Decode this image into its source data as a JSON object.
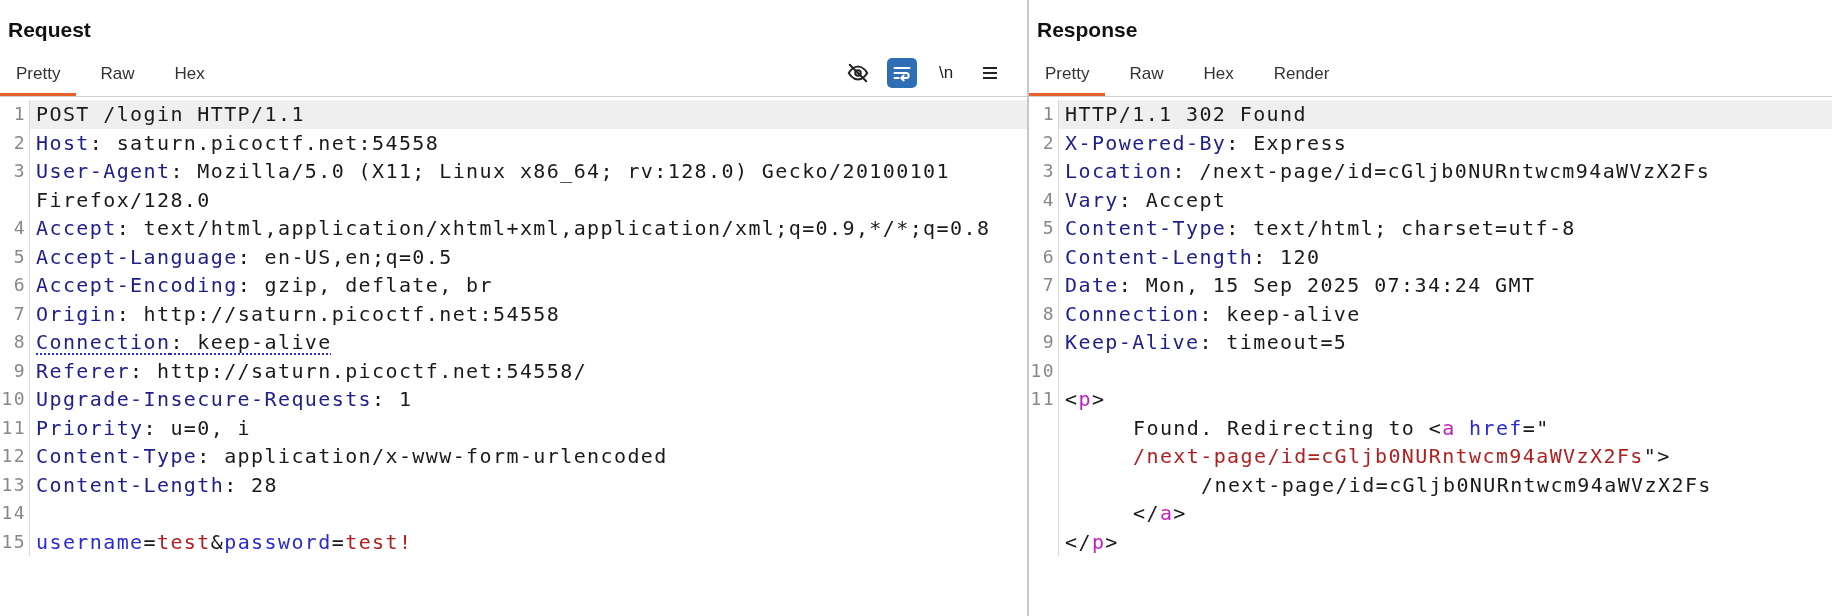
{
  "panels": [
    {
      "title": "Request",
      "tabs": [
        {
          "label": "Pretty",
          "selected": true
        },
        {
          "label": "Raw",
          "selected": false
        },
        {
          "label": "Hex",
          "selected": false
        }
      ],
      "toolbar": [
        {
          "kind": "hide",
          "on": false
        },
        {
          "kind": "wrap",
          "on": true
        },
        {
          "kind": "newline",
          "label": "\\n",
          "on": false
        },
        {
          "kind": "menu",
          "on": false
        }
      ],
      "lines": [
        {
          "number": "1",
          "highlighted": true,
          "segments": [
            {
              "kind": "plain",
              "text": "POST /login HTTP/1.1"
            }
          ]
        },
        {
          "number": "2",
          "highlighted": false,
          "segments": [
            {
              "kind": "name",
              "text": "Host"
            },
            {
              "kind": "plain",
              "text": ": saturn.picoctf.net:54558"
            }
          ]
        },
        {
          "number": "3",
          "highlighted": false,
          "segments": [
            {
              "kind": "name",
              "text": "User-Agent"
            },
            {
              "kind": "plain",
              "text": ": Mozilla/5.0 (X11; Linux x86_64; rv:128.0) Gecko/20100101 Firefox/128.0"
            }
          ]
        },
        {
          "number": "4",
          "highlighted": false,
          "segments": [
            {
              "kind": "name",
              "text": "Accept"
            },
            {
              "kind": "plain",
              "text": ": text/html,application/xhtml+xml,application/xml;q=0.9,*/*;q=0.8"
            }
          ]
        },
        {
          "number": "5",
          "highlighted": false,
          "segments": [
            {
              "kind": "name",
              "text": "Accept-Language"
            },
            {
              "kind": "plain",
              "text": ": en-US,en;q=0.5"
            }
          ]
        },
        {
          "number": "6",
          "highlighted": false,
          "segments": [
            {
              "kind": "name",
              "text": "Accept-Encoding"
            },
            {
              "kind": "plain",
              "text": ": gzip, deflate, br"
            }
          ]
        },
        {
          "number": "7",
          "highlighted": false,
          "segments": [
            {
              "kind": "name",
              "text": "Origin"
            },
            {
              "kind": "plain",
              "text": ": http://saturn.picoctf.net:54558"
            }
          ]
        },
        {
          "number": "8",
          "highlighted": false,
          "flagged": true,
          "segments": [
            {
              "kind": "name",
              "text": "Connection"
            },
            {
              "kind": "plain",
              "text": ": keep-alive"
            }
          ]
        },
        {
          "number": "9",
          "highlighted": false,
          "segments": [
            {
              "kind": "name",
              "text": "Referer"
            },
            {
              "kind": "plain",
              "text": ": http://saturn.picoctf.net:54558/"
            }
          ]
        },
        {
          "number": "10",
          "highlighted": false,
          "segments": [
            {
              "kind": "name",
              "text": "Upgrade-Insecure-Requests"
            },
            {
              "kind": "plain",
              "text": ": 1"
            }
          ]
        },
        {
          "number": "11",
          "highlighted": false,
          "segments": [
            {
              "kind": "name",
              "text": "Priority"
            },
            {
              "kind": "plain",
              "text": ": u=0, i"
            }
          ]
        },
        {
          "number": "12",
          "highlighted": false,
          "segments": [
            {
              "kind": "name",
              "text": "Content-Type"
            },
            {
              "kind": "plain",
              "text": ": application/x-www-form-urlencoded"
            }
          ]
        },
        {
          "number": "13",
          "highlighted": false,
          "segments": [
            {
              "kind": "name",
              "text": "Content-Length"
            },
            {
              "kind": "plain",
              "text": ": 28"
            }
          ]
        },
        {
          "number": "14",
          "highlighted": false
        },
        {
          "number": "15",
          "highlighted": false,
          "segments": [
            {
              "kind": "param",
              "text": "username"
            },
            {
              "kind": "plain",
              "text": "="
            },
            {
              "kind": "string",
              "text": "test"
            },
            {
              "kind": "plain",
              "text": "&"
            },
            {
              "kind": "param",
              "text": "password"
            },
            {
              "kind": "plain",
              "text": "="
            },
            {
              "kind": "string",
              "text": "test!"
            }
          ]
        }
      ]
    },
    {
      "title": "Response",
      "tabs": [
        {
          "label": "Pretty",
          "selected": true
        },
        {
          "label": "Raw",
          "selected": false
        },
        {
          "label": "Hex",
          "selected": false
        },
        {
          "label": "Render",
          "selected": false
        }
      ],
      "lines": [
        {
          "number": "1",
          "highlighted": true,
          "segments": [
            {
              "kind": "plain",
              "text": "HTTP/1.1 302 Found"
            }
          ]
        },
        {
          "number": "2",
          "highlighted": false,
          "segments": [
            {
              "kind": "name",
              "text": "X-Powered-By"
            },
            {
              "kind": "plain",
              "text": ": Express"
            }
          ]
        },
        {
          "number": "3",
          "highlighted": false,
          "segments": [
            {
              "kind": "name",
              "text": "Location"
            },
            {
              "kind": "plain",
              "text": ": /next-page/id=cGljb0NURntwcm94aWVzX2Fs"
            }
          ]
        },
        {
          "number": "4",
          "highlighted": false,
          "segments": [
            {
              "kind": "name",
              "text": "Vary"
            },
            {
              "kind": "plain",
              "text": ": Accept"
            }
          ]
        },
        {
          "number": "5",
          "highlighted": false,
          "segments": [
            {
              "kind": "name",
              "text": "Content-Type"
            },
            {
              "kind": "plain",
              "text": ": text/html; charset=utf-8"
            }
          ]
        },
        {
          "number": "6",
          "highlighted": false,
          "segments": [
            {
              "kind": "name",
              "text": "Content-Length"
            },
            {
              "kind": "plain",
              "text": ": 120"
            }
          ]
        },
        {
          "number": "7",
          "highlighted": false,
          "segments": [
            {
              "kind": "name",
              "text": "Date"
            },
            {
              "kind": "plain",
              "text": ": Mon, 15 Sep 2025 07:34:24 GMT"
            }
          ]
        },
        {
          "number": "8",
          "highlighted": false,
          "segments": [
            {
              "kind": "name",
              "text": "Connection"
            },
            {
              "kind": "plain",
              "text": ": keep-alive"
            }
          ]
        },
        {
          "number": "9",
          "highlighted": false,
          "segments": [
            {
              "kind": "name",
              "text": "Keep-Alive"
            },
            {
              "kind": "plain",
              "text": ": timeout=5"
            }
          ]
        },
        {
          "number": "10",
          "highlighted": false
        },
        {
          "number": "11",
          "highlighted": false,
          "segments": [
            {
              "kind": "plain",
              "text": "<"
            },
            {
              "kind": "tag",
              "text": "p"
            },
            {
              "kind": "plain",
              "text": ">"
            }
          ],
          "children": [
            {
              "segments": [
                {
                  "kind": "plain",
                  "text": "Found. Redirecting to <"
                },
                {
                  "kind": "tag",
                  "text": "a"
                },
                {
                  "kind": "param",
                  "text": " href"
                },
                {
                  "kind": "plain",
                  "text": "=\""
                }
              ]
            },
            {
              "segments": [
                {
                  "kind": "string",
                  "text": "/next-page/id=cGljb0NURntwcm94aWVzX2Fs"
                },
                {
                  "kind": "plain",
                  "text": "\">"
                }
              ],
              "children": [
                {
                  "segments": [
                    {
                      "kind": "plain",
                      "text": "/next-page/id=cGljb0NURntwcm94aWVzX2Fs"
                    }
                  ]
                }
              ]
            },
            {
              "segments": [
                {
                  "kind": "plain",
                  "text": "</"
                },
                {
                  "kind": "tag",
                  "text": "a"
                },
                {
                  "kind": "plain",
                  "text": ">"
                }
              ]
            }
          ]
        },
        {
          "segments": [
            {
              "kind": "plain",
              "text": "</"
            },
            {
              "kind": "tag",
              "text": "p"
            },
            {
              "kind": "plain",
              "text": ">"
            }
          ]
        }
      ]
    }
  ]
}
